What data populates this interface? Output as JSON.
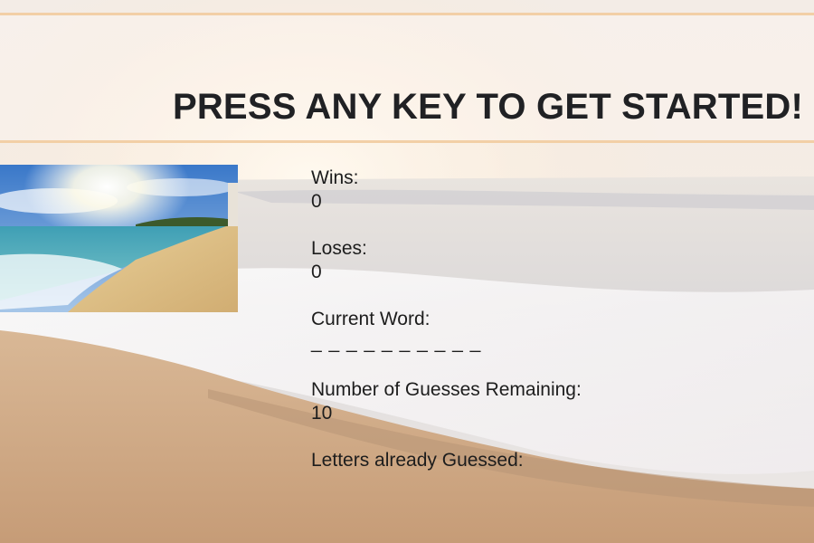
{
  "header": {
    "title": "PRESS ANY KEY TO GET STARTED!"
  },
  "thumbnail": {
    "icon": "beach-photo"
  },
  "stats": {
    "wins_label": "Wins:",
    "wins_value": "0",
    "losses_label": "Loses:",
    "losses_value": "0",
    "current_word_label": "Current Word:",
    "current_word_value": "_ _ _ _ _ _ _ _ _ _",
    "guesses_label": "Number of Guesses Remaining:",
    "guesses_value": "10",
    "letters_label": "Letters already Guessed:",
    "letters_value": ""
  },
  "colors": {
    "header_border": "#f2cfa6",
    "text": "#1d1d1d",
    "title": "#202124"
  }
}
